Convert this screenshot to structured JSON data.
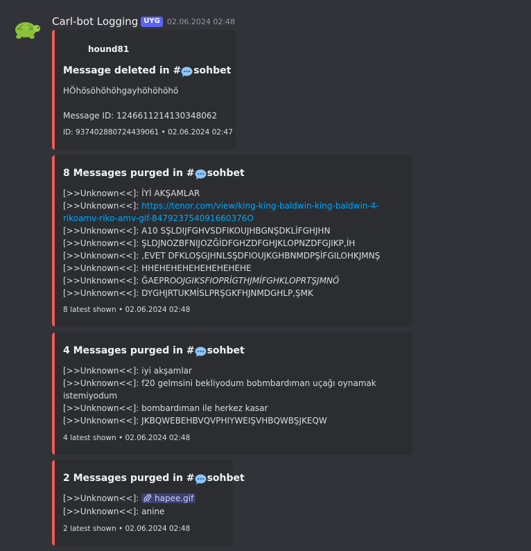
{
  "message": {
    "author": "Carl-bot Logging",
    "tag": "UYG",
    "timestamp": "02.06.2024 02:48"
  },
  "embeds": [
    {
      "author": "hound81",
      "title_prefix": "Message deleted in #",
      "channel": "sohbet",
      "content": "HÖhösöhöhöhgayhöhöhöhö",
      "message_id": "Message ID: 1246611214130348062",
      "footer": "ID: 937402880724439061 • 02.06.2024 02:47"
    },
    {
      "title_prefix": "8 Messages purged in #",
      "channel": "sohbet",
      "lines": [
        {
          "prefix": "[>>Unknown<<]: ",
          "text": "İYİ AKŞAMLAR"
        },
        {
          "prefix": "[>>Unknown<<]: ",
          "link": "https://tenor.com/view/king-king-baldwin-king-baldwin-4-",
          "link2": "rikoamv-riko-amv-gif-847923754091660376О"
        },
        {
          "prefix": "[>>Unknown<<]: ",
          "text": "A10 SŞLDIJFGHVSDFIKOUJHBGNŞDKLİFGHJHN"
        },
        {
          "prefix": "[>>Unknown<<]: ",
          "text": "ŞLDJNOZBFNIJOZĞİDFGHZDFGHJKLOPNZDFGJIKP,İH"
        },
        {
          "prefix": "[>>Unknown<<]: ",
          "text": ",EVET DFKLOŞGJHNLSŞDFIOUJKGHBNMDPŞİFGILOHKJMNŞ"
        },
        {
          "prefix": "[>>Unknown<<]: ",
          "text": "HHEHEHEHEHEHEHEHEHE"
        },
        {
          "prefix": "[>>Unknown<<]: ",
          "text": "ĞAEPRO",
          "italic": "OJGIKSFIOPRİGTHJMİFGHKLOPRTŞJMNÖ"
        },
        {
          "prefix": "[>>Unknown<<]: ",
          "text": "DYGHJRTUKMİSLPRŞGKFHJNMDGHLP,ŞMK"
        }
      ],
      "footer": "8 latest shown • 02.06.2024 02:48"
    },
    {
      "title_prefix": "4 Messages purged in #",
      "channel": "sohbet",
      "lines": [
        {
          "prefix": "[>>Unknown<<]: ",
          "text": "iyi akşamlar"
        },
        {
          "prefix": "[>>Unknown<<]: ",
          "text": "f20 gelmsini bekliyodum bobmbardıman uçağı oynamak"
        },
        {
          "prefix": "",
          "text": "istemiyodum"
        },
        {
          "prefix": "[>>Unknown<<]: ",
          "text": "bombardıman ile herkez kasar"
        },
        {
          "prefix": "[>>Unknown<<]: ",
          "text": "JKBQWEBEHBVQVPHIYWEIŞVHBQWBŞJKEQW"
        }
      ],
      "footer": "4 latest shown • 02.06.2024 02:48"
    },
    {
      "title_prefix": "2 Messages purged in #",
      "channel": "sohbet",
      "lines": [
        {
          "prefix": "[>>Unknown<<]: ",
          "attachment": "hapee.gif"
        },
        {
          "prefix": "[>>Unknown<<]: ",
          "text": "anine"
        }
      ],
      "footer": "2 latest shown • 02.06.2024 02:48"
    }
  ],
  "colors": {
    "background": "#313338",
    "embed_bg": "#2b2d31",
    "embed_border": "#f05959",
    "link": "#00a8fc",
    "tag": "#5865f2"
  },
  "icons": {
    "avatar": "turtle-icon",
    "channel": "speech-bubble-icon",
    "attachment": "paperclip-icon"
  }
}
